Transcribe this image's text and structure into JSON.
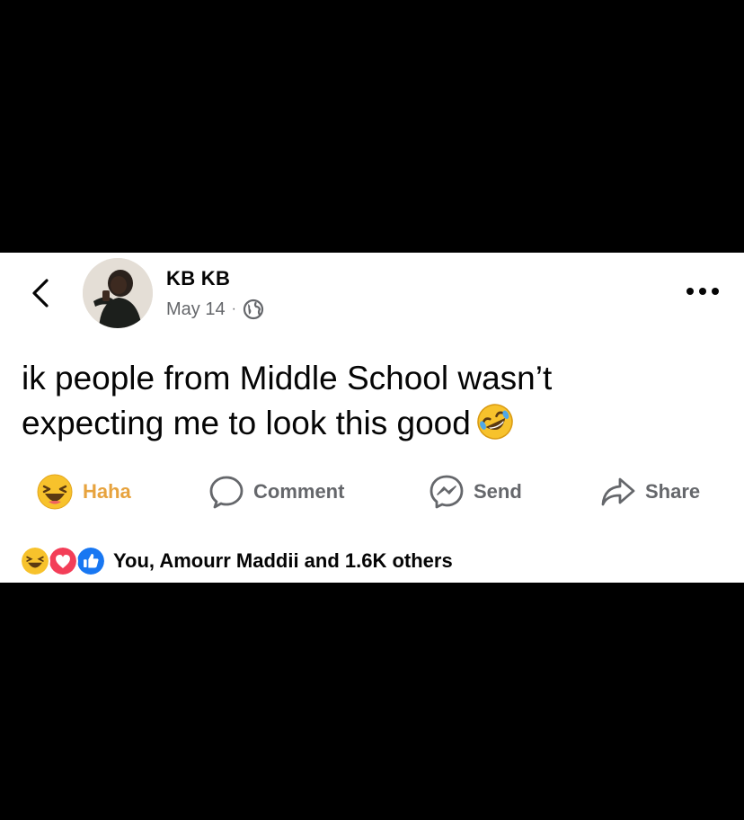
{
  "post": {
    "author": {
      "name": "KB KB"
    },
    "date": "May 14",
    "separator": "·",
    "audience_icon": "globe-icon",
    "text_line1": "ik people from Middle School wasn’t",
    "text_line2": "expecting me to look this good",
    "text_emoji": "rolling-on-floor-laughing-emoji"
  },
  "actions": {
    "haha": {
      "label": "Haha",
      "icon": "haha-emoji-icon",
      "color": "#e7a33e"
    },
    "comment": {
      "label": "Comment",
      "icon": "comment-bubble-icon"
    },
    "send": {
      "label": "Send",
      "icon": "messenger-icon"
    },
    "share": {
      "label": "Share",
      "icon": "share-arrow-icon"
    }
  },
  "reactions": {
    "icons": [
      "haha-icon",
      "love-icon",
      "like-icon"
    ],
    "summary": "You, Amourr Maddii and 1.6K others"
  },
  "colors": {
    "background": "#000000",
    "card": "#ffffff",
    "text": "#050505",
    "muted": "#65676b",
    "like_blue": "#1877f2",
    "love_red": "#f33e58",
    "haha_yellow": "#f7b125"
  }
}
